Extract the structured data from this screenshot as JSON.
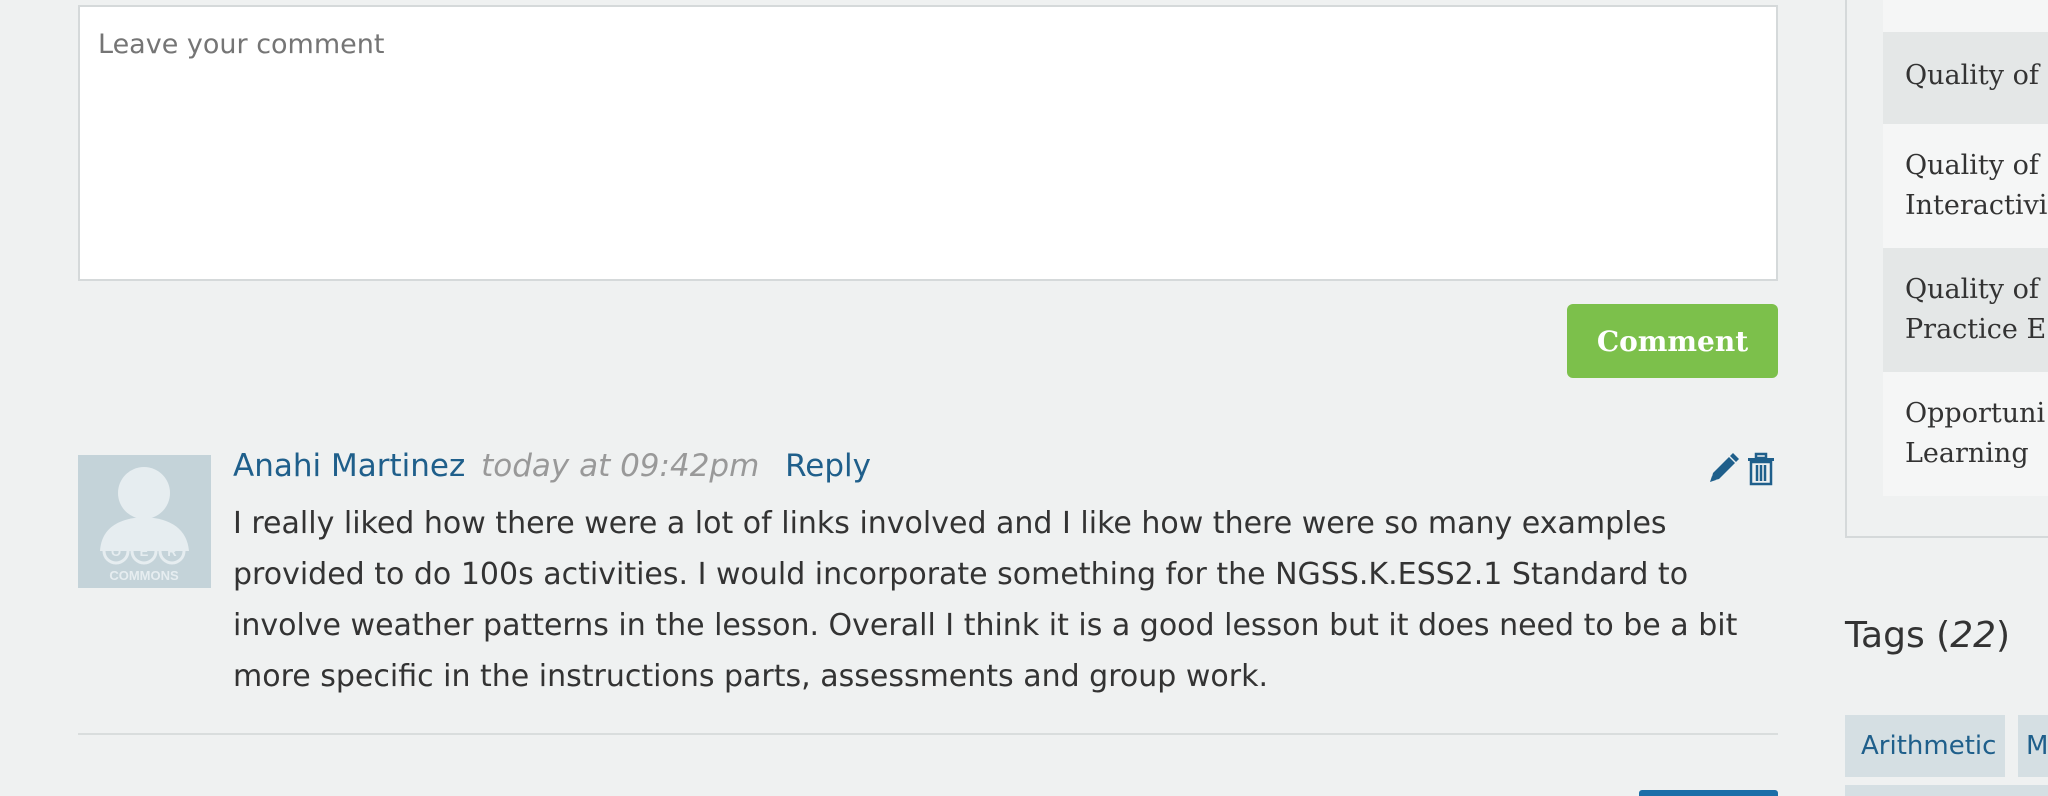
{
  "comment_form": {
    "placeholder": "Leave your comment",
    "value": "",
    "submit_label": "Comment"
  },
  "comment": {
    "author": "Anahi Martinez",
    "timestamp": "today at 09:42pm",
    "reply_label": "Reply",
    "body": "I really liked how there were a lot of links involved and I like how there were so many examples provided to do 100s activities. I would incorporate something for the NGSS.K.ESS2.1 Standard to involve weather patterns in the lesson. Overall I think it is a good lesson but it does need to be a bit more specific in the instructions parts, assessments and group work.",
    "avatar_logo_text": "OER",
    "avatar_caption": "COMMONS",
    "edit_icon": "pencil-icon",
    "delete_icon": "trash-icon"
  },
  "sidebar": {
    "criteria": [
      {
        "line1": "Quality of",
        "line2": ""
      },
      {
        "line1": "Quality of",
        "line2": "Interactivi"
      },
      {
        "line1": "Quality of",
        "line2": "Practice E"
      },
      {
        "line1": "Opportuni",
        "line2": "Learning"
      }
    ]
  },
  "tags": {
    "title": "Tags",
    "count": "22",
    "items": [
      "Arithmetic",
      "M"
    ]
  },
  "colors": {
    "accent_green": "#7cc04b",
    "link_blue": "#1f5f8b",
    "tag_bg": "#d5dfe3"
  }
}
